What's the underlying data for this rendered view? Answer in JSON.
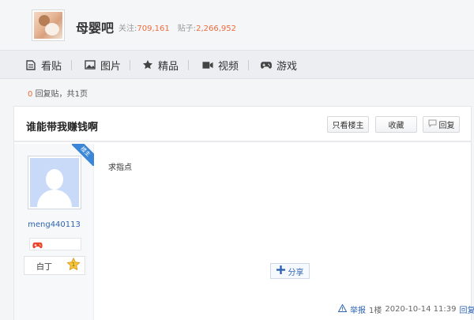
{
  "header": {
    "forum_name": "母婴吧",
    "follow_label": "关注:",
    "follow_count": "709,161",
    "post_label": "贴子:",
    "post_count": "2,266,952"
  },
  "nav": {
    "tabs": [
      {
        "label": "看贴",
        "icon": "document-icon"
      },
      {
        "label": "图片",
        "icon": "image-icon"
      },
      {
        "label": "精品",
        "icon": "star-icon"
      },
      {
        "label": "视频",
        "icon": "video-icon"
      },
      {
        "label": "游戏",
        "icon": "gamepad-icon"
      }
    ]
  },
  "reply_bar": {
    "count": "0",
    "text_mid": "回复贴，共",
    "pages": "1",
    "text_end": "页"
  },
  "thread": {
    "title": "谁能带我赚钱啊",
    "buttons": {
      "only_op": "只看楼主",
      "favorite": "收藏",
      "reply": "回复"
    }
  },
  "author": {
    "op_badge": "楼主",
    "username": "meng440113",
    "level_name": "白丁"
  },
  "post": {
    "content": "求指点",
    "share_label": "分享",
    "report_label": "举报",
    "floor": "1楼",
    "timestamp": "2020-10-14 11:39",
    "reply_label": "回复"
  },
  "colors": {
    "accent_orange": "#f06b3b",
    "link_blue": "#2d64b3",
    "op_badge_blue": "#3b86d6"
  }
}
